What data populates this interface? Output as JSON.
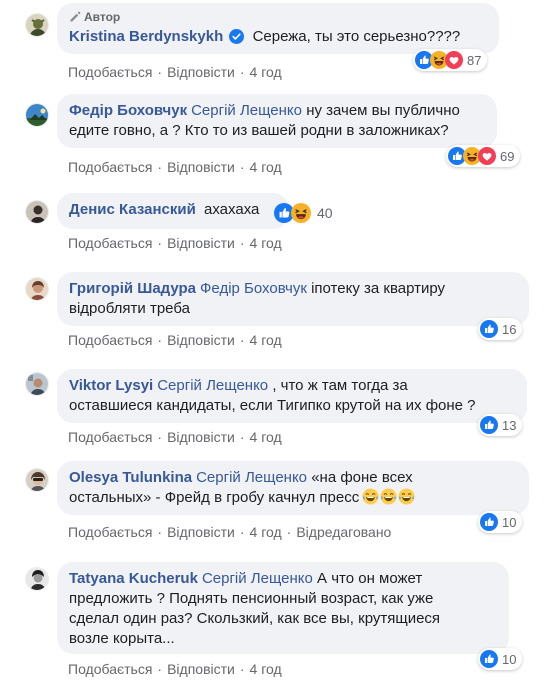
{
  "colors": {
    "link": "#385898",
    "bubble": "#f0f2f5",
    "meta": "#65676b",
    "like": "#1877f2",
    "love": "#f33e58",
    "haha": "#f7b125"
  },
  "common": {
    "like_label": "Подобається",
    "reply_label": "Відповісти",
    "edited_label": "Відредаговано",
    "author_badge": "Автор"
  },
  "comments": [
    {
      "author": "Kristina Berdynskykh",
      "is_author": true,
      "verified": true,
      "mention": "",
      "text": "Сережа, ты это серьезно????",
      "time": "4 год",
      "reactions": [
        "like",
        "haha",
        "love"
      ],
      "reaction_count": "87"
    },
    {
      "author": "Федір Боховчук",
      "mention": "Сергій Лещенко",
      "text": "ну зачем вы публично едите говно, а ? Кто то из вашей родни в заложниках?",
      "line1": "ну зачем вы публично",
      "line2": "едите говно, а ? Кто то из вашей родни в заложниках?",
      "time": "4 год",
      "reactions": [
        "like",
        "haha",
        "love"
      ],
      "reaction_count": "69"
    },
    {
      "author": "Денис Казанский",
      "mention": "",
      "text": "ахахаха",
      "time": "4 год",
      "reactions": [
        "like",
        "haha"
      ],
      "reaction_count": "40"
    },
    {
      "author": "Григорій Шадура",
      "mention": "Федір Боховчук",
      "text": "іпотеку за квартиру відробляти треба",
      "line1": "іпотеку за квартиру",
      "line2": "відробляти треба",
      "time": "4 год",
      "reactions": [
        "like"
      ],
      "reaction_count": "16"
    },
    {
      "author": "Viktor Lysyi",
      "mention": "Сергій Лещенко",
      "text": ", что ж там тогда за оставшиеся кандидаты, если Тигипко крутой на их фоне ?",
      "line1": ", что ж там тогда за",
      "line2": "оставшиеся кандидаты, если Тигипко крутой на их фоне ?",
      "time": "4 год",
      "reactions": [
        "like"
      ],
      "reaction_count": "13"
    },
    {
      "author": "Olesya Tulunkina",
      "mention": "Сергій Лещенко",
      "text": "«на фоне всех остальных» - Фрейд в гробу качнул пресс",
      "line1": "«на фоне всех",
      "line2": "остальных» - Фрейд в гробу качнул пресс",
      "time": "4 год",
      "edited": true,
      "reactions": [
        "like"
      ],
      "reaction_count": "10"
    },
    {
      "author": "Tatyana Kucheruk",
      "mention": "Сергій Лещенко",
      "text": "А что он может предложить ? Поднять пенсионный возраст, как уже сделал один раз? Скользкий, как все вы, крутящиеся возле корыта...",
      "line1": "А что он может",
      "line2": "предложить ? Поднять пенсионный возраст, как уже",
      "line3": "сделал один раз? Скользкий, как все вы, крутящиеся",
      "line4": "возле корыта...",
      "time": "4 год",
      "reactions": [
        "like"
      ],
      "reaction_count": "10"
    }
  ]
}
